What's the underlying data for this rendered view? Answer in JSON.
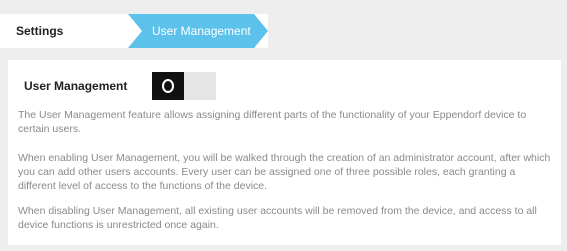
{
  "breadcrumb": {
    "items": [
      "Settings",
      "User Management"
    ],
    "active_color": "#5cc2ec"
  },
  "section": {
    "label": "User Management",
    "toggle_state": "off"
  },
  "paragraphs": [
    "The User Management feature allows assigning different parts of the functionality of your Eppendorf device to certain users.",
    "When enabling User Management, you will be walked through the creation of an administrator account, after which you can add other users accounts. Every user can be assigned one of three possible roles, each granting a different level of access to the functions of the device.",
    "When disabling User Management, all existing user accounts will be removed from the device, and access to all device functions is unrestricted once again."
  ]
}
